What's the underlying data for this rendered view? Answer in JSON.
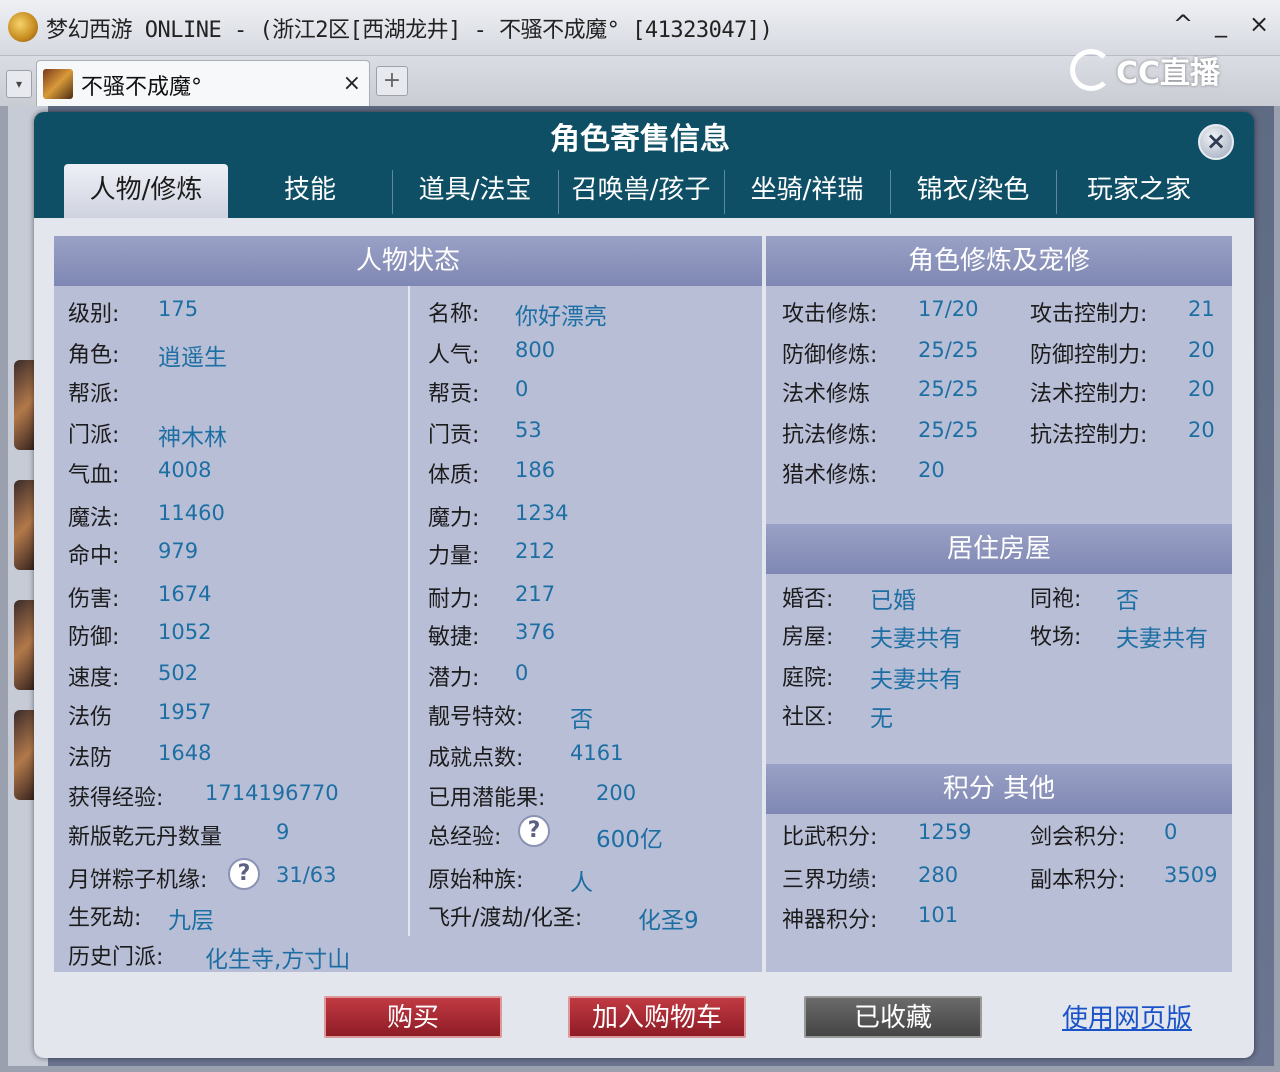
{
  "window": {
    "title": "梦幻西游 ONLINE - (浙江2区[西湖龙井] - 不骚不成魔° [41323047])",
    "controls": {
      "collapse": "^",
      "minimize": "_",
      "close": "×"
    }
  },
  "browser_tab": {
    "label": "不骚不成魔°",
    "close": "×",
    "add": "+",
    "dropdown": "▾"
  },
  "stream_logo": "CC直播",
  "dialog": {
    "title": "角色寄售信息",
    "close": "×",
    "tabs": [
      "人物/修炼",
      "技能",
      "道具/法宝",
      "召唤兽/孩子",
      "坐骑/祥瑞",
      "锦衣/染色",
      "玩家之家"
    ],
    "active_tab": 0
  },
  "status": {
    "header": "人物状态",
    "left": [
      {
        "label": "级别:",
        "value": "175"
      },
      {
        "label": "角色:",
        "value": "逍遥生"
      },
      {
        "label": "帮派:",
        "value": ""
      },
      {
        "label": "门派:",
        "value": "神木林"
      },
      {
        "label": "气血:",
        "value": "4008"
      },
      {
        "label": "魔法:",
        "value": "11460"
      },
      {
        "label": "命中:",
        "value": "979"
      },
      {
        "label": "伤害:",
        "value": "1674"
      },
      {
        "label": "防御:",
        "value": "1052"
      },
      {
        "label": "速度:",
        "value": "502"
      },
      {
        "label": "法伤",
        "value": "1957"
      },
      {
        "label": "法防",
        "value": "1648"
      },
      {
        "label": "获得经验:",
        "value": "1714196770"
      },
      {
        "label": "新版乾元丹数量",
        "value": "9"
      },
      {
        "label": "月饼粽子机缘:",
        "value": "31/63"
      },
      {
        "label": "生死劫:",
        "value": "九层"
      },
      {
        "label": "历史门派:",
        "value": "化生寺,方寸山"
      }
    ],
    "right": [
      {
        "label": "名称:",
        "value": "你好漂亮"
      },
      {
        "label": "人气:",
        "value": "800"
      },
      {
        "label": "帮贡:",
        "value": "0"
      },
      {
        "label": "门贡:",
        "value": "53"
      },
      {
        "label": "体质:",
        "value": "186"
      },
      {
        "label": "魔力:",
        "value": "1234"
      },
      {
        "label": "力量:",
        "value": "212"
      },
      {
        "label": "耐力:",
        "value": "217"
      },
      {
        "label": "敏捷:",
        "value": "376"
      },
      {
        "label": "潜力:",
        "value": "0"
      },
      {
        "label": "靓号特效:",
        "value": "否"
      },
      {
        "label": "成就点数:",
        "value": "4161"
      },
      {
        "label": "已用潜能果:",
        "value": "200"
      },
      {
        "label": "总经验:",
        "value": "600亿"
      },
      {
        "label": "原始种族:",
        "value": "人"
      },
      {
        "label": "飞升/渡劫/化圣:",
        "value": "化圣9"
      }
    ],
    "help": "?"
  },
  "cultivation": {
    "header": "角色修炼及宠修",
    "rows": [
      {
        "l1": "攻击修炼:",
        "v1": "17/20",
        "l2": "攻击控制力:",
        "v2": "21"
      },
      {
        "l1": "防御修炼:",
        "v1": "25/25",
        "l2": "防御控制力:",
        "v2": "20"
      },
      {
        "l1": "法术修炼",
        "v1": "25/25",
        "l2": "法术控制力:",
        "v2": "20"
      },
      {
        "l1": "抗法修炼:",
        "v1": "25/25",
        "l2": "抗法控制力:",
        "v2": "20"
      },
      {
        "l1": "猎术修炼:",
        "v1": "20",
        "l2": "",
        "v2": ""
      }
    ]
  },
  "housing": {
    "header": "居住房屋",
    "rows": [
      {
        "l1": "婚否:",
        "v1": "已婚",
        "l2": "同袍:",
        "v2": "否"
      },
      {
        "l1": "房屋:",
        "v1": "夫妻共有",
        "l2": "牧场:",
        "v2": "夫妻共有"
      },
      {
        "l1": "庭院:",
        "v1": "夫妻共有",
        "l2": "",
        "v2": ""
      },
      {
        "l1": "社区:",
        "v1": "无",
        "l2": "",
        "v2": ""
      }
    ]
  },
  "points": {
    "header": "积分 其他",
    "rows": [
      {
        "l1": "比武积分:",
        "v1": "1259",
        "l2": "剑会积分:",
        "v2": "0"
      },
      {
        "l1": "三界功绩:",
        "v1": "280",
        "l2": "副本积分:",
        "v2": "3509"
      },
      {
        "l1": "神器积分:",
        "v1": "101",
        "l2": "",
        "v2": ""
      }
    ]
  },
  "buttons": {
    "buy": "购买",
    "add_cart": "加入购物车",
    "favorited": "已收藏",
    "web": "使用网页版"
  },
  "colors": {
    "dialog_bg": "#0f4f66",
    "value_text": "#1d6fa3",
    "panel_bg": "#b9bed7",
    "buy_red": "#a52a33"
  }
}
